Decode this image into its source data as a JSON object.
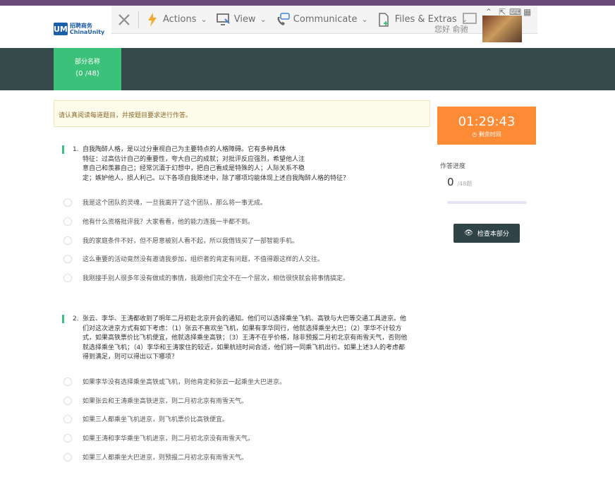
{
  "toolbar": {
    "actions": "Actions",
    "view": "View",
    "communicate": "Communicate",
    "files": "Files & Extras"
  },
  "header": {
    "logo_mark": "UM",
    "logo_text": "招聘商务 ChinaUnity",
    "greeting": "您好 俞驰"
  },
  "section": {
    "name": "部分名称",
    "count": "(0 /48)"
  },
  "notice": "请认真阅读每道题目，并按题目要求进行作答。",
  "timer": {
    "time": "01:29:43",
    "label": "剩余时间"
  },
  "progress": {
    "label": "作答进度",
    "answered": "0",
    "total": "/48题",
    "fraction": 0
  },
  "review_button": "检查本部分",
  "questions": [
    {
      "num": "1.",
      "stem": "自我陶醉人格，是以过分重视自己为主要特点的人格障碍。它有多种具体\n特征：过高估计自己的重要性，夸大自己的成就；对批评反应强烈，希望他人注\n意自己和羡慕自己；经常沉湎于幻想中，把自己看成是特殊的人；人际关系不稳\n定；嫉妒他人，损人利己。以下各项自我陈述中，除了哪项均能体现上述自我陶醉人格的特征？",
      "options": [
        "我是这个团队的灵魂，一旦我离开了这个团队，那么将一事无成。",
        "他有什么资格批评我？大家看看，他的能力连我一半都不到。",
        "我的家庭条件不好，但不愿意被别人看不起，所以我借钱买了一部智能手机。",
        "这么重要的活动竟然没有邀请我参加，组织者的肯定有问题，不值得跟这样的人交往。",
        "我刚接手别人很多年没有做成的事情，我跟他们完全不在一个层次，相信很快就会将事情搞定。"
      ]
    },
    {
      "num": "2.",
      "stem": "张云、李华、王涛都收到了明年二月初赴北京开会的通知。他们可以选择乘坐飞机、高铁与大巴等交通工具进京。他\n们对这次进京方式有如下考虑：（1）张云不喜欢坐飞机，如果有李华同行，他就选择乘坐大巴；（2）李华不计较方\n式，如果高铁票价比飞机便宜，他就选择乘坐高铁；（3）王涛不在乎价格，除非预报二月初北京有雨雪天气，否则他\n就选择乘坐飞机；（4）李华和王涛家住的较近，如果航班时间合适，他们将一同乘飞机出行。如果上述3人的考虑都\n得到满足，则可以得出以下哪项？",
      "options": [
        "如果李华没有选择乘坐高铁或飞机，则他肯定和张云一起乘坐大巴进京。",
        "如果张云和王涛乘坐高铁进京，则二月初北京有雨雪天气。",
        "如果三人都乘坐飞机进京，则飞机票价比高铁便宜。",
        "如果王涛和李华乘坐飞机进京，则二月初北京没有雨雪天气。",
        "如果三人都乘坐大巴进京，则预报二月初北京有雨雪天气。"
      ]
    }
  ]
}
